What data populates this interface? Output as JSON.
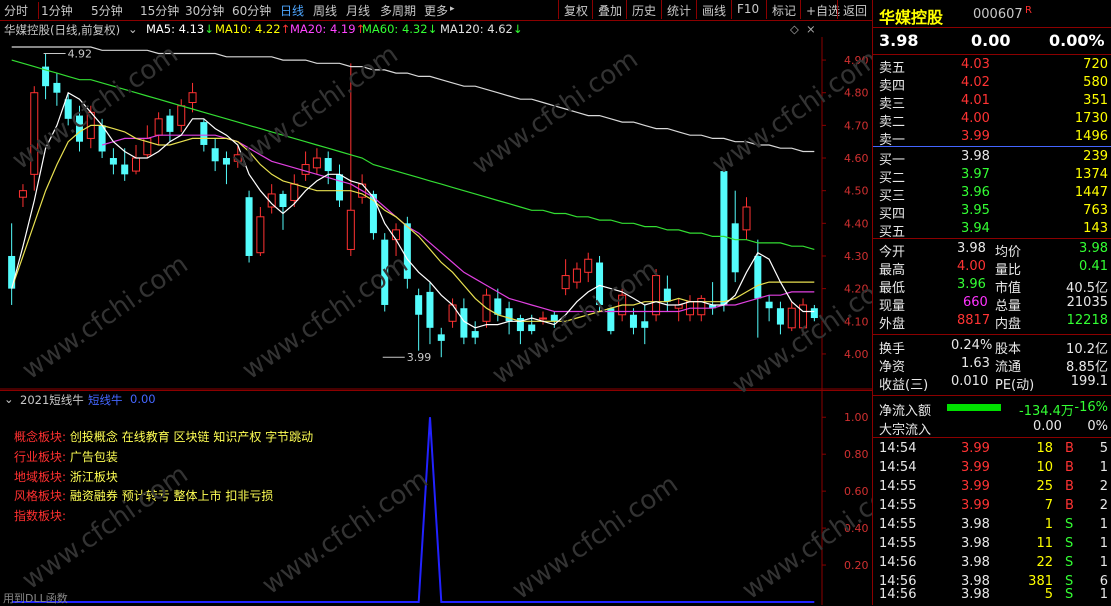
{
  "toolbar": {
    "periods": [
      "分时",
      "1分钟",
      "5分钟",
      "15分钟",
      "30分钟",
      "60分钟",
      "日线",
      "周线",
      "月线",
      "多周期",
      "更多"
    ],
    "active_period": "日线",
    "more_arrow": "▸",
    "actions": [
      "复权",
      "叠加",
      "历史",
      "统计",
      "画线",
      "F10",
      "标记",
      "+自选",
      "返回"
    ]
  },
  "ma_bar": {
    "title": "华媒控股(日线,前复权)",
    "items": [
      {
        "label": "MA5: 4.13",
        "arrow": "↓",
        "color": "#ffffff"
      },
      {
        "label": "MA10: 4.22",
        "arrow": "↑",
        "color": "#ffff00"
      },
      {
        "label": "MA20: 4.19",
        "arrow": "↑",
        "color": "#ff44ff"
      },
      {
        "label": "MA60: 4.32",
        "arrow": "↓",
        "color": "#33ff33"
      },
      {
        "label": "MA120: 4.62",
        "arrow": "↓",
        "color": "#e0e0e0"
      }
    ]
  },
  "chart_data": [
    {
      "type": "candlestick",
      "title": "华媒控股(日线,前复权)",
      "ylim": [
        3.96,
        4.94
      ],
      "y_ticks": [
        "4.90",
        "4.80",
        "4.70",
        "4.60",
        "4.50",
        "4.40",
        "4.30",
        "4.20",
        "4.10",
        "4.00"
      ],
      "annotations": [
        {
          "text": "4.92",
          "price": 4.92,
          "index": 3
        },
        {
          "text": "3.99",
          "price": 3.99,
          "index": 33
        }
      ],
      "candles": [
        [
          4.3,
          4.2,
          4.4,
          4.15
        ],
        [
          4.48,
          4.5,
          4.52,
          4.45
        ],
        [
          4.55,
          4.8,
          4.82,
          4.5
        ],
        [
          4.88,
          4.82,
          4.92,
          4.78
        ],
        [
          4.83,
          4.8,
          4.86,
          4.76
        ],
        [
          4.78,
          4.72,
          4.8,
          4.7
        ],
        [
          4.73,
          4.65,
          4.76,
          4.62
        ],
        [
          4.66,
          4.74,
          4.76,
          4.63
        ],
        [
          4.7,
          4.62,
          4.72,
          4.6
        ],
        [
          4.6,
          4.58,
          4.63,
          4.55
        ],
        [
          4.58,
          4.55,
          4.63,
          4.53
        ],
        [
          4.56,
          4.6,
          4.64,
          4.55
        ],
        [
          4.61,
          4.66,
          4.7,
          4.6
        ],
        [
          4.67,
          4.72,
          4.74,
          4.64
        ],
        [
          4.73,
          4.68,
          4.75,
          4.65
        ],
        [
          4.7,
          4.76,
          4.78,
          4.68
        ],
        [
          4.77,
          4.8,
          4.83,
          4.74
        ],
        [
          4.71,
          4.64,
          4.72,
          4.62
        ],
        [
          4.63,
          4.59,
          4.66,
          4.56
        ],
        [
          4.6,
          4.58,
          4.62,
          4.52
        ],
        [
          4.59,
          4.61,
          4.64,
          4.57
        ],
        [
          4.48,
          4.3,
          4.5,
          4.28
        ],
        [
          4.31,
          4.42,
          4.45,
          4.3
        ],
        [
          4.45,
          4.49,
          4.52,
          4.43
        ],
        [
          4.49,
          4.45,
          4.5,
          4.38
        ],
        [
          4.47,
          4.52,
          4.55,
          4.45
        ],
        [
          4.55,
          4.58,
          4.62,
          4.53
        ],
        [
          4.57,
          4.6,
          4.63,
          4.55
        ],
        [
          4.6,
          4.56,
          4.62,
          4.52
        ],
        [
          4.55,
          4.47,
          4.58,
          4.45
        ],
        [
          4.32,
          4.44,
          4.89,
          4.3
        ],
        [
          4.48,
          4.52,
          4.55,
          4.46
        ],
        [
          4.49,
          4.37,
          4.5,
          4.35
        ],
        [
          4.35,
          4.15,
          4.37,
          4.13
        ],
        [
          4.35,
          4.38,
          4.4,
          4.3
        ],
        [
          4.4,
          4.23,
          4.42,
          4.2
        ],
        [
          4.18,
          4.12,
          4.2,
          4.01
        ],
        [
          4.19,
          4.08,
          4.22,
          4.03
        ],
        [
          4.06,
          4.04,
          4.08,
          3.99
        ],
        [
          4.1,
          4.15,
          4.17,
          4.08
        ],
        [
          4.14,
          4.05,
          4.17,
          4.03
        ],
        [
          4.07,
          4.05,
          4.1,
          4.03
        ],
        [
          4.1,
          4.18,
          4.2,
          4.08
        ],
        [
          4.17,
          4.12,
          4.2,
          4.1
        ],
        [
          4.14,
          4.1,
          4.16,
          4.06
        ],
        [
          4.11,
          4.07,
          4.12,
          4.03
        ],
        [
          4.09,
          4.07,
          4.12,
          4.06
        ],
        [
          4.11,
          4.11,
          4.13,
          4.09
        ],
        [
          4.12,
          4.1,
          4.13,
          4.08
        ],
        [
          4.2,
          4.24,
          4.29,
          4.18
        ],
        [
          4.22,
          4.26,
          4.28,
          4.2
        ],
        [
          4.25,
          4.29,
          4.31,
          4.22
        ],
        [
          4.28,
          4.15,
          4.3,
          4.13
        ],
        [
          4.14,
          4.07,
          4.15,
          4.06
        ],
        [
          4.12,
          4.18,
          4.2,
          4.1
        ],
        [
          4.12,
          4.08,
          4.14,
          4.06
        ],
        [
          4.1,
          4.08,
          4.15,
          4.03
        ],
        [
          4.12,
          4.24,
          4.26,
          4.1
        ],
        [
          4.2,
          4.16,
          4.24,
          4.13
        ],
        [
          4.14,
          4.15,
          4.17,
          4.1
        ],
        [
          4.12,
          4.16,
          4.18,
          4.1
        ],
        [
          4.12,
          4.17,
          4.18,
          4.1
        ],
        [
          4.15,
          4.14,
          4.22,
          4.12
        ],
        [
          4.56,
          4.15,
          4.57,
          4.13
        ],
        [
          4.4,
          4.25,
          4.5,
          4.22
        ],
        [
          4.38,
          4.45,
          4.48,
          4.35
        ],
        [
          4.3,
          4.17,
          4.35,
          4.05
        ],
        [
          4.16,
          4.14,
          4.18,
          4.1
        ],
        [
          4.14,
          4.09,
          4.16,
          4.06
        ],
        [
          4.08,
          4.14,
          4.16,
          4.07
        ],
        [
          4.08,
          4.15,
          4.17,
          4.06
        ],
        [
          4.14,
          4.11,
          4.15,
          4.1
        ]
      ],
      "ma5": [
        4.2,
        4.33,
        4.47,
        4.63,
        4.7,
        4.8,
        4.78,
        4.74,
        4.7,
        4.65,
        4.62,
        4.6,
        4.6,
        4.62,
        4.65,
        4.67,
        4.72,
        4.72,
        4.69,
        4.67,
        4.64,
        4.55,
        4.5,
        4.46,
        4.43,
        4.46,
        4.5,
        4.53,
        4.55,
        4.55,
        4.53,
        4.52,
        4.48,
        4.4,
        4.35,
        4.29,
        4.25,
        4.22,
        4.18,
        4.15,
        4.1,
        4.08,
        4.09,
        4.09,
        4.1,
        4.1,
        4.11,
        4.1,
        4.09,
        4.12,
        4.16,
        4.19,
        4.21,
        4.2,
        4.19,
        4.17,
        4.15,
        4.16,
        4.15,
        4.15,
        4.16,
        4.16,
        4.15,
        4.15,
        4.18,
        4.25,
        4.31,
        4.29,
        4.22,
        4.16,
        4.13,
        4.13
      ],
      "ma10": [
        4.2,
        4.3,
        4.4,
        4.5,
        4.58,
        4.65,
        4.68,
        4.7,
        4.7,
        4.69,
        4.68,
        4.66,
        4.65,
        4.64,
        4.64,
        4.65,
        4.66,
        4.66,
        4.66,
        4.66,
        4.65,
        4.62,
        4.58,
        4.55,
        4.53,
        4.52,
        4.51,
        4.5,
        4.5,
        4.5,
        4.5,
        4.49,
        4.47,
        4.44,
        4.42,
        4.39,
        4.36,
        4.32,
        4.28,
        4.25,
        4.21,
        4.17,
        4.14,
        4.12,
        4.11,
        4.1,
        4.1,
        4.1,
        4.1,
        4.1,
        4.11,
        4.12,
        4.13,
        4.14,
        4.15,
        4.15,
        4.16,
        4.16,
        4.16,
        4.17,
        4.16,
        4.16,
        4.16,
        4.16,
        4.17,
        4.19,
        4.21,
        4.22,
        4.22,
        4.22,
        4.22,
        4.22
      ],
      "ma20": [
        null,
        null,
        null,
        null,
        null,
        null,
        null,
        null,
        4.64,
        4.65,
        4.66,
        4.66,
        4.66,
        4.67,
        4.67,
        4.67,
        4.67,
        4.67,
        4.67,
        4.66,
        4.65,
        4.63,
        4.61,
        4.59,
        4.58,
        4.57,
        4.56,
        4.55,
        4.54,
        4.53,
        4.52,
        4.5,
        4.48,
        4.45,
        4.42,
        4.39,
        4.37,
        4.34,
        4.31,
        4.28,
        4.25,
        4.23,
        4.21,
        4.19,
        4.17,
        4.16,
        4.15,
        4.14,
        4.13,
        4.13,
        4.13,
        4.13,
        4.13,
        4.13,
        4.13,
        4.13,
        4.13,
        4.13,
        4.13,
        4.13,
        4.14,
        4.14,
        4.14,
        4.15,
        4.15,
        4.16,
        4.17,
        4.18,
        4.18,
        4.19,
        4.19,
        4.19
      ],
      "ma60": [
        4.9,
        4.89,
        4.88,
        4.87,
        4.86,
        4.85,
        4.84,
        4.84,
        4.83,
        4.82,
        4.81,
        4.8,
        4.79,
        4.78,
        4.77,
        4.76,
        4.75,
        4.74,
        4.73,
        4.72,
        4.71,
        4.7,
        4.69,
        4.68,
        4.67,
        4.66,
        4.65,
        4.64,
        4.63,
        4.62,
        4.61,
        4.6,
        4.58,
        4.57,
        4.56,
        4.55,
        4.54,
        4.53,
        4.52,
        4.51,
        4.5,
        4.49,
        4.48,
        4.47,
        4.46,
        4.45,
        4.44,
        4.44,
        4.43,
        4.43,
        4.42,
        4.42,
        4.41,
        4.41,
        4.4,
        4.4,
        4.39,
        4.39,
        4.38,
        4.38,
        4.37,
        4.37,
        4.36,
        4.36,
        4.35,
        4.35,
        4.34,
        4.34,
        4.34,
        4.33,
        4.33,
        4.32
      ],
      "ma120": [
        4.94,
        4.94,
        4.94,
        4.94,
        4.94,
        4.94,
        4.94,
        4.94,
        4.93,
        4.93,
        4.93,
        4.93,
        4.93,
        4.92,
        4.92,
        4.92,
        4.92,
        4.92,
        4.92,
        4.91,
        4.91,
        4.91,
        4.91,
        4.91,
        4.9,
        4.9,
        4.9,
        4.89,
        4.89,
        4.89,
        4.88,
        4.88,
        4.87,
        4.87,
        4.86,
        4.86,
        4.85,
        4.85,
        4.84,
        4.83,
        4.82,
        4.82,
        4.81,
        4.8,
        4.79,
        4.78,
        4.78,
        4.77,
        4.76,
        4.75,
        4.74,
        4.73,
        4.73,
        4.72,
        4.71,
        4.71,
        4.7,
        4.69,
        4.69,
        4.68,
        4.67,
        4.67,
        4.66,
        4.66,
        4.65,
        4.65,
        4.64,
        4.64,
        4.63,
        4.63,
        4.62,
        4.62
      ]
    },
    {
      "type": "line",
      "title": "2021短线牛",
      "series": [
        {
          "name": "短线牛",
          "values": [
            0,
            0,
            0,
            0,
            0,
            0,
            0,
            0,
            0,
            0,
            0,
            0,
            0,
            0,
            0,
            0,
            0,
            0,
            0,
            0,
            0,
            0,
            0,
            0,
            0,
            0,
            0,
            0,
            0,
            0,
            0,
            0,
            0,
            0,
            0,
            0,
            0,
            0,
            0,
            0,
            0,
            0,
            0,
            0,
            0,
            0,
            0,
            0,
            0,
            0,
            0,
            0,
            0,
            0,
            0,
            0,
            0,
            0,
            0,
            0,
            0,
            0,
            0,
            0,
            0,
            0,
            0,
            0,
            0,
            0,
            0,
            0
          ]
        }
      ],
      "spike_index": 37,
      "spike_value": 1.0,
      "ylim": [
        0,
        1.05
      ],
      "y_ticks": [
        "1.00",
        "0.80",
        "0.60",
        "0.40",
        "0.20"
      ]
    }
  ],
  "sub_header": {
    "title": "2021短线牛",
    "series_label": "短线牛",
    "value": "0.00"
  },
  "blocks": [
    {
      "label": "概念板块:",
      "value": "创投概念 在线教育 区块链 知识产权 字节跳动"
    },
    {
      "label": "行业板块:",
      "value": "广告包装"
    },
    {
      "label": "地域板块:",
      "value": "浙江板块"
    },
    {
      "label": "风格板块:",
      "value": "融资融券 预计转亏 整体上市 扣非亏损"
    },
    {
      "label": "指数板块:",
      "value": ""
    }
  ],
  "bottom_note": "用到DLL函数",
  "watermark": "www.cfchi.com",
  "right": {
    "name": "华媒控股",
    "code": "000607",
    "badge": "R",
    "price": "3.98",
    "change": "0.00",
    "pct": "0.00%",
    "asks": [
      {
        "label": "卖五",
        "price": "4.03",
        "vol": "720"
      },
      {
        "label": "卖四",
        "price": "4.02",
        "vol": "580"
      },
      {
        "label": "卖三",
        "price": "4.01",
        "vol": "351"
      },
      {
        "label": "卖二",
        "price": "4.00",
        "vol": "1730"
      },
      {
        "label": "卖一",
        "price": "3.99",
        "vol": "1496"
      }
    ],
    "bids": [
      {
        "label": "买一",
        "price": "3.98",
        "vol": "239"
      },
      {
        "label": "买二",
        "price": "3.97",
        "vol": "1374"
      },
      {
        "label": "买三",
        "price": "3.96",
        "vol": "1447"
      },
      {
        "label": "买四",
        "price": "3.95",
        "vol": "763"
      },
      {
        "label": "买五",
        "price": "3.94",
        "vol": "143"
      }
    ],
    "stats": [
      {
        "l1": "今开",
        "v1": "3.98",
        "l2": "均价",
        "v2": "3.98"
      },
      {
        "l1": "最高",
        "v1": "4.00",
        "l2": "量比",
        "v2": "0.41"
      },
      {
        "l1": "最低",
        "v1": "3.96",
        "l2": "市值",
        "v2": "40.5亿"
      },
      {
        "l1": "现量",
        "v1": "660",
        "l2": "总量",
        "v2": "21035"
      },
      {
        "l1": "外盘",
        "v1": "8817",
        "l2": "内盘",
        "v2": "12218"
      }
    ],
    "stats2": [
      {
        "l1": "换手",
        "v1": "0.24%",
        "l2": "股本",
        "v2": "10.2亿"
      },
      {
        "l1": "净资",
        "v1": "1.63",
        "l2": "流通",
        "v2": "8.85亿"
      },
      {
        "l1": "收益(三)",
        "v1": "0.010",
        "l2": "PE(动)",
        "v2": "199.1"
      }
    ],
    "flow": {
      "label": "净流入额",
      "value": "-134.4万",
      "pct": "-16%"
    },
    "block": {
      "label": "大宗流入",
      "value": "0.00",
      "pct": "0%"
    },
    "ticks": [
      {
        "t": "14:54",
        "p": "3.99",
        "v": "18",
        "d": "B",
        "n": "5"
      },
      {
        "t": "14:54",
        "p": "3.99",
        "v": "10",
        "d": "B",
        "n": "1"
      },
      {
        "t": "14:55",
        "p": "3.99",
        "v": "25",
        "d": "B",
        "n": "2"
      },
      {
        "t": "14:55",
        "p": "3.99",
        "v": "7",
        "d": "B",
        "n": "2"
      },
      {
        "t": "14:55",
        "p": "3.98",
        "v": "1",
        "d": "S",
        "n": "1"
      },
      {
        "t": "14:55",
        "p": "3.98",
        "v": "11",
        "d": "S",
        "n": "1"
      },
      {
        "t": "14:56",
        "p": "3.98",
        "v": "22",
        "d": "S",
        "n": "1"
      },
      {
        "t": "14:56",
        "p": "3.98",
        "v": "381",
        "d": "S",
        "n": "6"
      },
      {
        "t": "14:56",
        "p": "3.98",
        "v": "5",
        "d": "S",
        "n": "1"
      }
    ]
  }
}
